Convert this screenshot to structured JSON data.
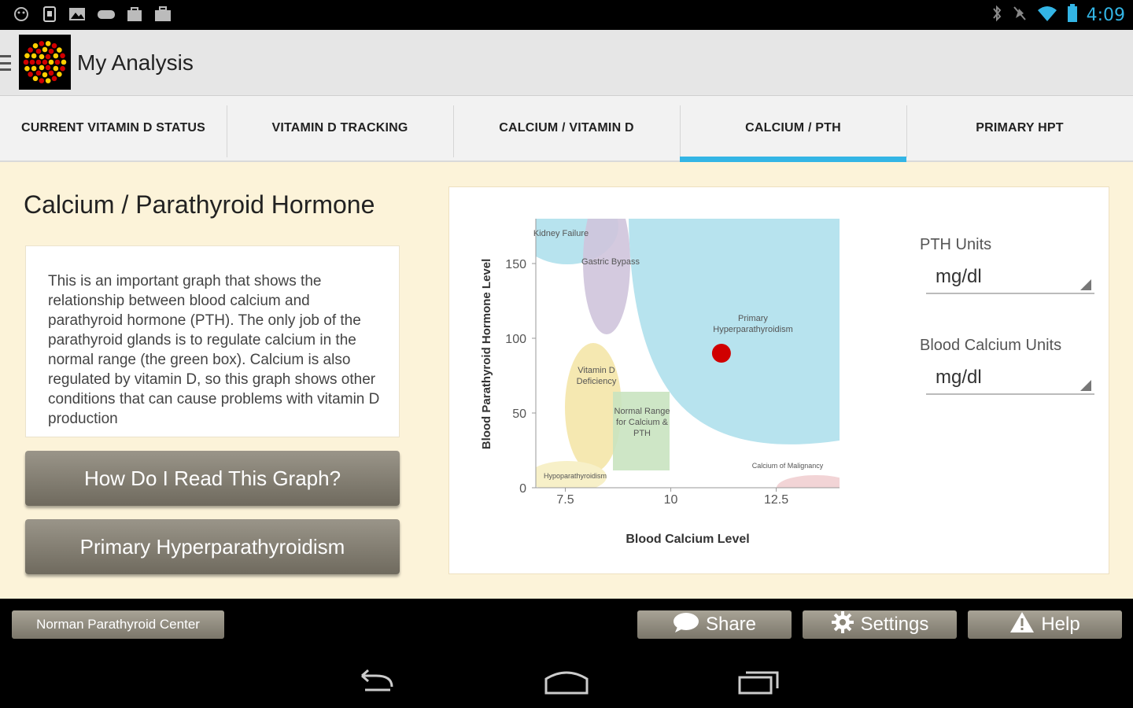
{
  "status_bar": {
    "time": "4:09",
    "left_icons": [
      "android-icon",
      "sd-card-icon",
      "photo-icon",
      "game-icon",
      "shopping-bag-icon",
      "briefcase-icon"
    ],
    "right_icons": [
      "bluetooth-icon",
      "mute-icon",
      "wifi-icon",
      "battery-icon"
    ]
  },
  "action_bar": {
    "title": "My Analysis"
  },
  "tabs": [
    {
      "label": "CURRENT VITAMIN D STATUS",
      "active": false
    },
    {
      "label": "VITAMIN D TRACKING",
      "active": false
    },
    {
      "label": "CALCIUM / VITAMIN D",
      "active": false
    },
    {
      "label": "CALCIUM / PTH",
      "active": true
    },
    {
      "label": "PRIMARY HPT",
      "active": false
    }
  ],
  "main": {
    "title": "Calcium / Parathyroid Hormone",
    "description": "This is an important graph that shows the relationship between blood calcium and parathyroid hormone (PTH). The only job of the parathyroid glands is to regulate calcium in the normal range (the green box). Calcium is also regulated by vitamin D, so this graph shows other conditions that can cause problems with vitamin D production",
    "buttons": {
      "read_graph": "How Do I Read This Graph?",
      "primary_hpt": "Primary Hyperparathyroidism"
    }
  },
  "chart_data": {
    "type": "scatter",
    "xlabel": "Blood Calcium Level",
    "ylabel": "Blood Parathyroid Hormone Level",
    "xlim": [
      6.8,
      14
    ],
    "ylim": [
      0,
      180
    ],
    "x_ticks": [
      "7.5",
      "10",
      "12.5"
    ],
    "y_ticks": [
      "0",
      "50",
      "100",
      "150"
    ],
    "regions": [
      {
        "label": "Kidney Failure",
        "color": "#b7e3ee"
      },
      {
        "label": "Gastric Bypass",
        "color": "#cfc4dc"
      },
      {
        "label": "Primary Hyperparathyroidism",
        "color": "#b7e3ee"
      },
      {
        "label": "Vitamin D Deficiency",
        "color": "#f4e6a8"
      },
      {
        "label": "Normal Range for Calcium & PTH",
        "color": "#c9e3c0"
      },
      {
        "label": "Hypoparathyroidism",
        "color": "#f7f0c8"
      },
      {
        "label": "Calcium of Malignancy",
        "color": "#f2d4d6"
      }
    ],
    "points": [
      {
        "x": 11.2,
        "y": 90,
        "color": "#d00000"
      }
    ]
  },
  "units": {
    "pth_label": "PTH Units",
    "pth_value": "mg/dl",
    "calcium_label": "Blood Calcium Units",
    "calcium_value": "mg/dl"
  },
  "bottom_bar": {
    "center_label": "Norman Parathyroid Center",
    "share": "Share",
    "settings": "Settings",
    "help": "Help"
  }
}
